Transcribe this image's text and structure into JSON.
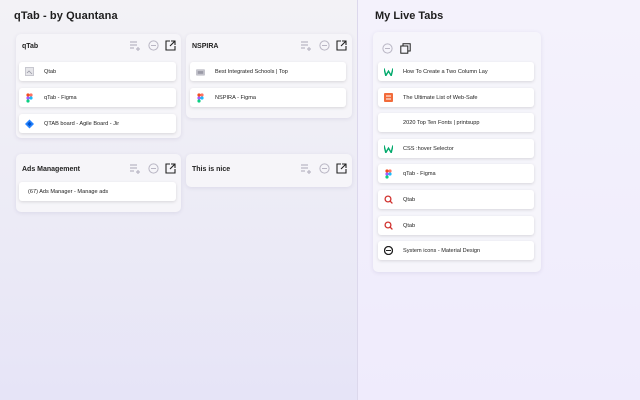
{
  "app": {
    "title": "qTab - by Quantana",
    "live_title": "My Live Tabs"
  },
  "colors": {
    "accent": "#6b5fd3",
    "icon_gray": "#b9b6c4",
    "icon_dark": "#222222"
  },
  "head_icons": [
    "playlist-add-icon",
    "minus-circle-icon",
    "open-external-icon"
  ],
  "live_head_icons": [
    "minus-circle-icon",
    "copy-icon"
  ],
  "groups": [
    {
      "title": "qTab",
      "tabs": [
        {
          "label": "Qtab",
          "icon": "page-icon"
        },
        {
          "label": "qTab - Figma",
          "icon": "figma-icon"
        },
        {
          "label": "QTAB board - Agile Board - Jir",
          "icon": "jira-icon"
        }
      ]
    },
    {
      "title": "NSPIRA",
      "tabs": [
        {
          "label": "Best Integrated Schools | Top",
          "icon": "school-icon"
        },
        {
          "label": "NSPIRA - Figma",
          "icon": "figma-icon"
        }
      ]
    },
    {
      "title": "Ads Management",
      "tabs": [
        {
          "label": "(67) Ads Manager - Manage ads",
          "icon": "page-icon"
        }
      ]
    },
    {
      "title": "This is nice",
      "tabs": []
    }
  ],
  "live_tabs": [
    {
      "label": "How To Create a Two Column Lay",
      "icon": "w3schools-icon"
    },
    {
      "label": "The Ultimate List of Web-Safe",
      "icon": "orange-square-icon"
    },
    {
      "label": "2020 Top Ten Fonts | printsupp",
      "icon": "blank-icon"
    },
    {
      "label": "CSS :hover Selector",
      "icon": "w3schools-icon"
    },
    {
      "label": "qTab - Figma",
      "icon": "figma-icon"
    },
    {
      "label": "Qtab",
      "icon": "search-icon"
    },
    {
      "label": "Qtab",
      "icon": "search-icon"
    },
    {
      "label": "System icons - Material Design",
      "icon": "material-icon"
    }
  ]
}
